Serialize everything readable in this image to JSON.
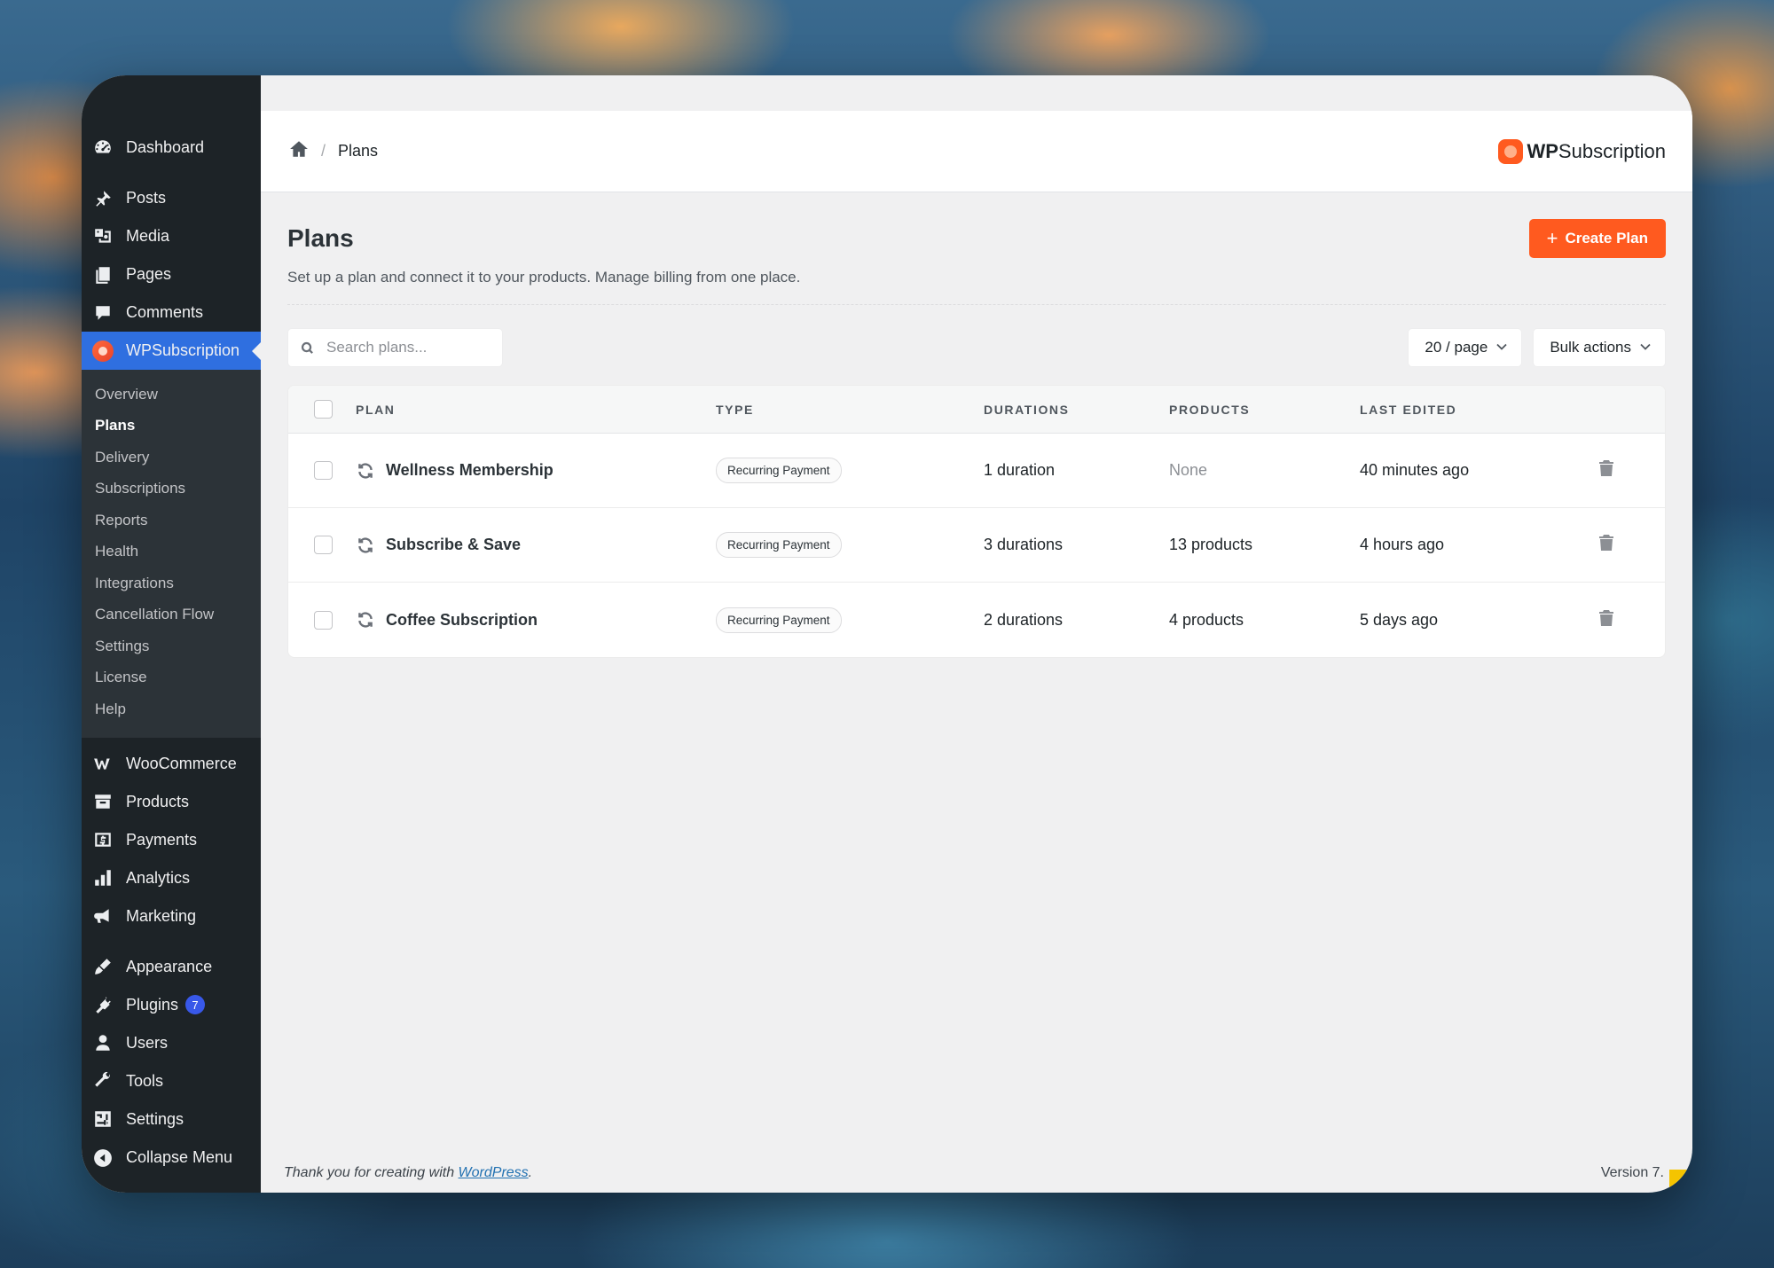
{
  "sidebar": {
    "top_items": [
      {
        "label": "Dashboard",
        "icon": "dashboard-icon"
      },
      {
        "label": "Posts",
        "icon": "pin-icon"
      },
      {
        "label": "Media",
        "icon": "media-icon"
      },
      {
        "label": "Pages",
        "icon": "pages-icon"
      },
      {
        "label": "Comments",
        "icon": "comment-icon"
      },
      {
        "label": "WPSubscription",
        "icon": "wpsubscription-logo-icon"
      }
    ],
    "submenu": [
      {
        "label": "Overview"
      },
      {
        "label": "Plans"
      },
      {
        "label": "Delivery"
      },
      {
        "label": "Subscriptions"
      },
      {
        "label": "Reports"
      },
      {
        "label": "Health"
      },
      {
        "label": "Integrations"
      },
      {
        "label": "Cancellation Flow"
      },
      {
        "label": "Settings"
      },
      {
        "label": "License"
      },
      {
        "label": "Help"
      }
    ],
    "commerce_items": [
      {
        "label": "WooCommerce",
        "icon": "woocommerce-icon"
      },
      {
        "label": "Products",
        "icon": "archive-icon"
      },
      {
        "label": "Payments",
        "icon": "payments-icon"
      },
      {
        "label": "Analytics",
        "icon": "bar-chart-icon"
      },
      {
        "label": "Marketing",
        "icon": "megaphone-icon"
      }
    ],
    "admin_items": [
      {
        "label": "Appearance",
        "icon": "brush-icon"
      },
      {
        "label": "Plugins",
        "icon": "plug-icon",
        "badge": "7"
      },
      {
        "label": "Users",
        "icon": "user-icon"
      },
      {
        "label": "Tools",
        "icon": "wrench-icon"
      },
      {
        "label": "Settings",
        "icon": "settings-icon"
      }
    ],
    "collapse_label": "Collapse Menu"
  },
  "header": {
    "breadcrumb_current": "Plans",
    "breadcrumb_separator": "/",
    "brand_bold": "WP",
    "brand_rest": "Subscription"
  },
  "page": {
    "title": "Plans",
    "description": "Set up a plan and connect it to your products. Manage billing from one place.",
    "create_button": "Create Plan",
    "create_button_plus": "+"
  },
  "toolbar": {
    "search_placeholder": "Search plans...",
    "per_page": "20 / page",
    "bulk_actions": "Bulk actions"
  },
  "table": {
    "headers": {
      "plan": "PLAN",
      "type": "TYPE",
      "durations": "DURATIONS",
      "products": "PRODUCTS",
      "last_edited": "LAST EDITED"
    },
    "rows": [
      {
        "plan": "Wellness Membership",
        "type": "Recurring Payment",
        "durations": "1 duration",
        "products": "None",
        "last_edited": "40 minutes ago"
      },
      {
        "plan": "Subscribe & Save",
        "type": "Recurring Payment",
        "durations": "3 durations",
        "products": "13 products",
        "last_edited": "4 hours ago"
      },
      {
        "plan": "Coffee Subscription",
        "type": "Recurring Payment",
        "durations": "2 durations",
        "products": "4 products",
        "last_edited": "5 days ago"
      }
    ]
  },
  "footer": {
    "thanks_prefix": "Thank you for creating with ",
    "thanks_link": "WordPress",
    "thanks_suffix": ".",
    "version": "Version 7."
  },
  "colors": {
    "accent": "#ff5a1f",
    "sidebar_bg": "#1d2327",
    "active_menu": "#2f6fe0",
    "badge": "#3858e9"
  }
}
